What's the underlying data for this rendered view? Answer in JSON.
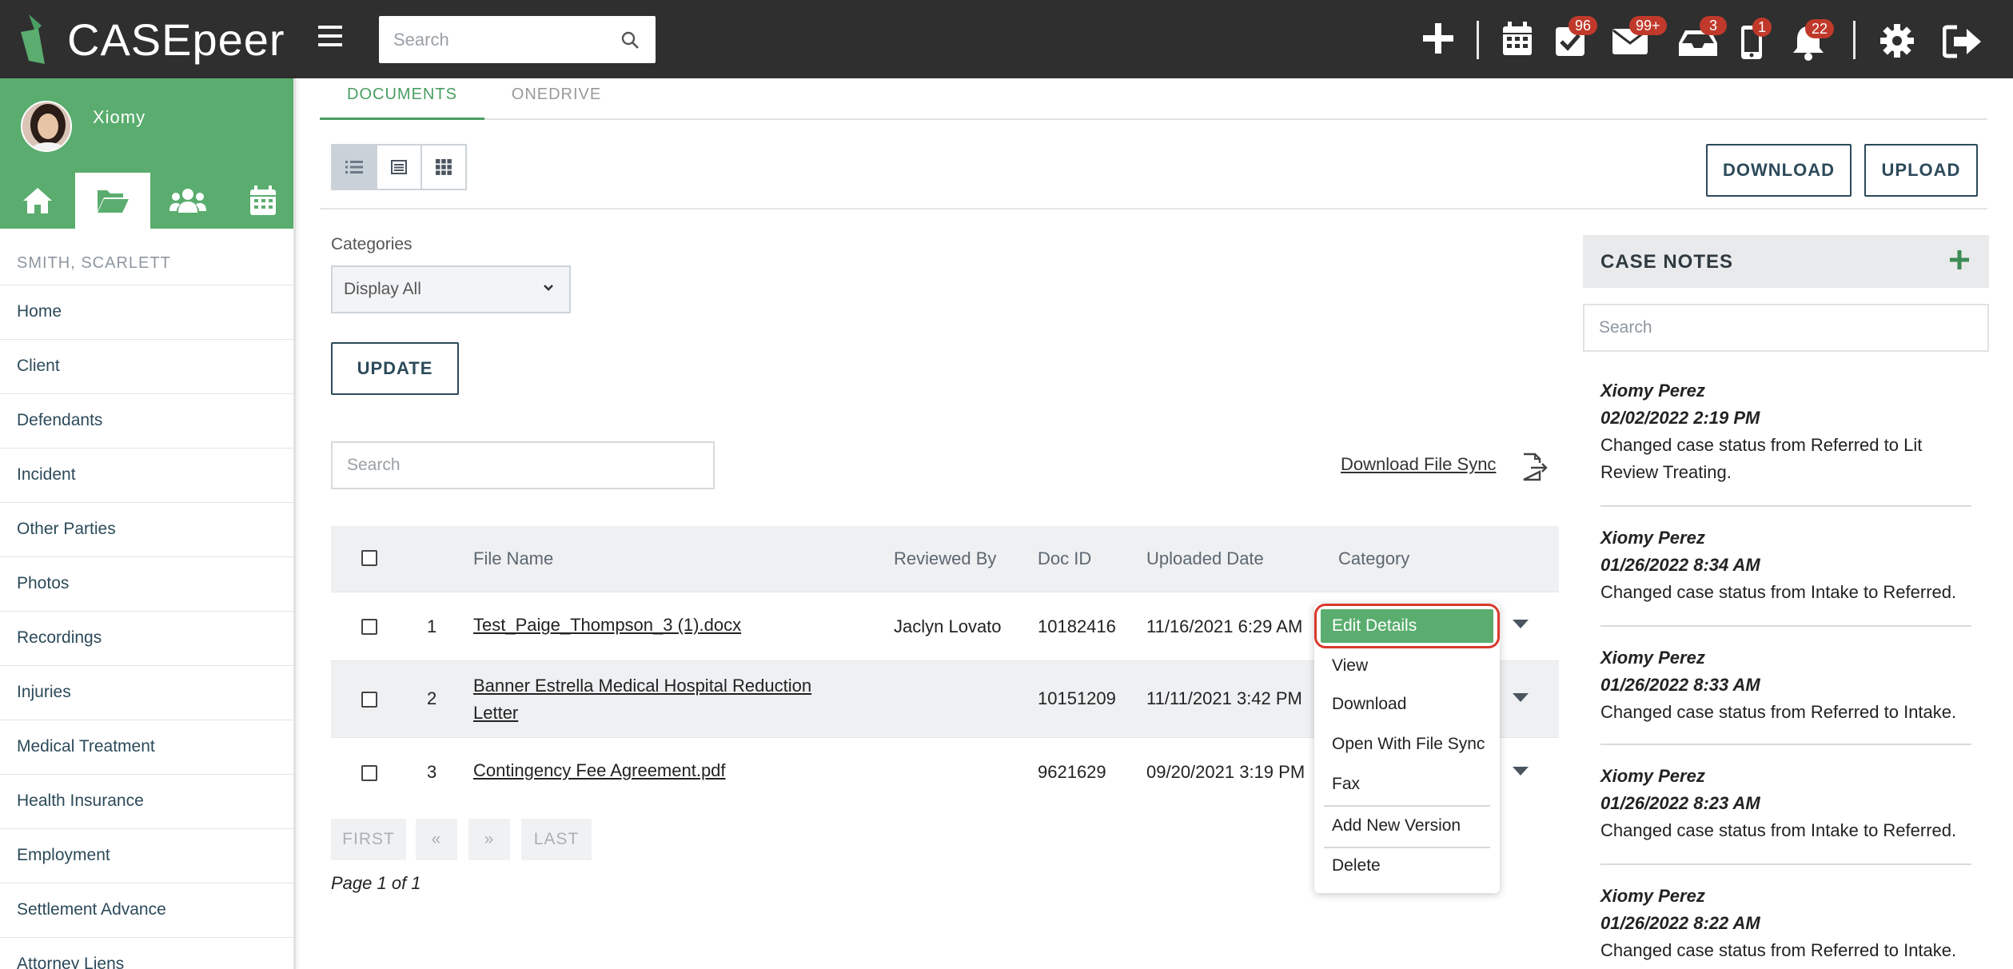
{
  "app": {
    "logo_text": "CASEpeer",
    "search_placeholder": "Search",
    "badges": {
      "tasks": "96",
      "mail": "99+",
      "inbox": "3",
      "phone": "1",
      "notifications": "22"
    },
    "icons": [
      "plus-icon",
      "calendar-icon",
      "tasks-icon",
      "mail-icon",
      "inbox-icon",
      "phone-icon",
      "bell-icon",
      "gear-icon",
      "logout-icon"
    ]
  },
  "sidebar": {
    "user_name": "Xiomy",
    "nav_icons": [
      "home-icon",
      "folder-open-icon",
      "users-icon",
      "calendar-icon"
    ],
    "case_name": "SMITH, SCARLETT",
    "items": [
      "Home",
      "Client",
      "Defendants",
      "Incident",
      "Other Parties",
      "Photos",
      "Recordings",
      "Injuries",
      "Medical Treatment",
      "Health Insurance",
      "Employment",
      "Settlement Advance",
      "Attorney Liens"
    ]
  },
  "tabs": {
    "documents": "DOCUMENTS",
    "onedrive": "ONEDRIVE"
  },
  "toolbar": {
    "download_label": "DOWNLOAD",
    "upload_label": "UPLOAD",
    "categories_label": "Categories",
    "categories_selected": "Display All",
    "update_label": "UPDATE",
    "doc_search_placeholder": "Search",
    "file_sync_label": "Download File Sync"
  },
  "table": {
    "headers": {
      "file_name": "File Name",
      "reviewed_by": "Reviewed By",
      "doc_id": "Doc ID",
      "uploaded_date": "Uploaded Date",
      "category": "Category"
    },
    "rows": [
      {
        "num": "1",
        "file_name": "Test_Paige_Thompson_3 (1).docx",
        "reviewed_by": "Jaclyn Lovato",
        "doc_id": "10182416",
        "uploaded_date": "11/16/2021 6:29 AM"
      },
      {
        "num": "2",
        "file_name": "Banner Estrella Medical Hospital Reduction Letter",
        "reviewed_by": "",
        "doc_id": "10151209",
        "uploaded_date": "11/11/2021 3:42 PM"
      },
      {
        "num": "3",
        "file_name": "Contingency Fee Agreement.pdf",
        "reviewed_by": "",
        "doc_id": "9621629",
        "uploaded_date": "09/20/2021 3:19 PM"
      }
    ]
  },
  "pagination": {
    "first": "FIRST",
    "prev": "«",
    "next": "»",
    "last": "LAST",
    "info": "Page 1 of 1"
  },
  "context_menu": {
    "items": [
      "Edit Details",
      "View",
      "Download",
      "Open With File Sync",
      "Fax",
      "Add New Version",
      "Delete"
    ],
    "highlighted": "Edit Details"
  },
  "case_notes": {
    "title": "CASE NOTES",
    "search_placeholder": "Search",
    "notes": [
      {
        "author": "Xiomy Perez",
        "date": "02/02/2022 2:19 PM",
        "text": "Changed case status from Referred to Lit Review Treating."
      },
      {
        "author": "Xiomy Perez",
        "date": "01/26/2022 8:34 AM",
        "text": "Changed case status from Intake to Referred."
      },
      {
        "author": "Xiomy Perez",
        "date": "01/26/2022 8:33 AM",
        "text": "Changed case status from Referred to Intake."
      },
      {
        "author": "Xiomy Perez",
        "date": "01/26/2022 8:23 AM",
        "text": "Changed case status from Intake to Referred."
      },
      {
        "author": "Xiomy Perez",
        "date": "01/26/2022 8:22 AM",
        "text": "Changed case status from Referred to Intake."
      }
    ]
  },
  "colors": {
    "brand_green": "#5aad6e",
    "topbar": "#2f2f2f",
    "badge": "#c0392b",
    "button_outline": "#2c4a5a",
    "highlight_ring": "#d9392b"
  }
}
